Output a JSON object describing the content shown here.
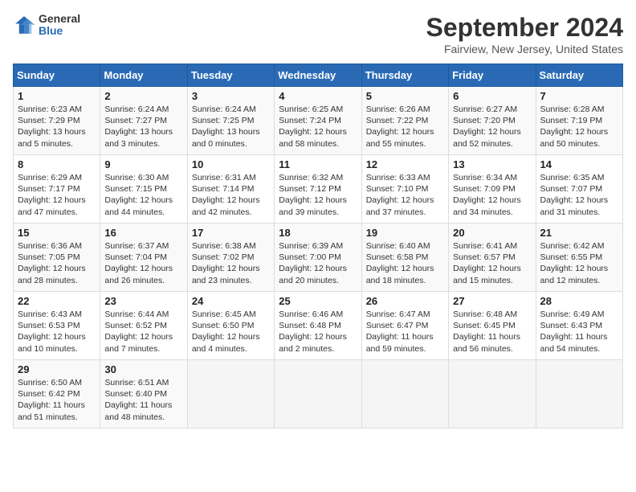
{
  "logo": {
    "general": "General",
    "blue": "Blue"
  },
  "title": "September 2024",
  "subtitle": "Fairview, New Jersey, United States",
  "headers": [
    "Sunday",
    "Monday",
    "Tuesday",
    "Wednesday",
    "Thursday",
    "Friday",
    "Saturday"
  ],
  "weeks": [
    [
      {
        "day": "1",
        "lines": [
          "Sunrise: 6:23 AM",
          "Sunset: 7:29 PM",
          "Daylight: 13 hours",
          "and 5 minutes."
        ]
      },
      {
        "day": "2",
        "lines": [
          "Sunrise: 6:24 AM",
          "Sunset: 7:27 PM",
          "Daylight: 13 hours",
          "and 3 minutes."
        ]
      },
      {
        "day": "3",
        "lines": [
          "Sunrise: 6:24 AM",
          "Sunset: 7:25 PM",
          "Daylight: 13 hours",
          "and 0 minutes."
        ]
      },
      {
        "day": "4",
        "lines": [
          "Sunrise: 6:25 AM",
          "Sunset: 7:24 PM",
          "Daylight: 12 hours",
          "and 58 minutes."
        ]
      },
      {
        "day": "5",
        "lines": [
          "Sunrise: 6:26 AM",
          "Sunset: 7:22 PM",
          "Daylight: 12 hours",
          "and 55 minutes."
        ]
      },
      {
        "day": "6",
        "lines": [
          "Sunrise: 6:27 AM",
          "Sunset: 7:20 PM",
          "Daylight: 12 hours",
          "and 52 minutes."
        ]
      },
      {
        "day": "7",
        "lines": [
          "Sunrise: 6:28 AM",
          "Sunset: 7:19 PM",
          "Daylight: 12 hours",
          "and 50 minutes."
        ]
      }
    ],
    [
      {
        "day": "8",
        "lines": [
          "Sunrise: 6:29 AM",
          "Sunset: 7:17 PM",
          "Daylight: 12 hours",
          "and 47 minutes."
        ]
      },
      {
        "day": "9",
        "lines": [
          "Sunrise: 6:30 AM",
          "Sunset: 7:15 PM",
          "Daylight: 12 hours",
          "and 44 minutes."
        ]
      },
      {
        "day": "10",
        "lines": [
          "Sunrise: 6:31 AM",
          "Sunset: 7:14 PM",
          "Daylight: 12 hours",
          "and 42 minutes."
        ]
      },
      {
        "day": "11",
        "lines": [
          "Sunrise: 6:32 AM",
          "Sunset: 7:12 PM",
          "Daylight: 12 hours",
          "and 39 minutes."
        ]
      },
      {
        "day": "12",
        "lines": [
          "Sunrise: 6:33 AM",
          "Sunset: 7:10 PM",
          "Daylight: 12 hours",
          "and 37 minutes."
        ]
      },
      {
        "day": "13",
        "lines": [
          "Sunrise: 6:34 AM",
          "Sunset: 7:09 PM",
          "Daylight: 12 hours",
          "and 34 minutes."
        ]
      },
      {
        "day": "14",
        "lines": [
          "Sunrise: 6:35 AM",
          "Sunset: 7:07 PM",
          "Daylight: 12 hours",
          "and 31 minutes."
        ]
      }
    ],
    [
      {
        "day": "15",
        "lines": [
          "Sunrise: 6:36 AM",
          "Sunset: 7:05 PM",
          "Daylight: 12 hours",
          "and 28 minutes."
        ]
      },
      {
        "day": "16",
        "lines": [
          "Sunrise: 6:37 AM",
          "Sunset: 7:04 PM",
          "Daylight: 12 hours",
          "and 26 minutes."
        ]
      },
      {
        "day": "17",
        "lines": [
          "Sunrise: 6:38 AM",
          "Sunset: 7:02 PM",
          "Daylight: 12 hours",
          "and 23 minutes."
        ]
      },
      {
        "day": "18",
        "lines": [
          "Sunrise: 6:39 AM",
          "Sunset: 7:00 PM",
          "Daylight: 12 hours",
          "and 20 minutes."
        ]
      },
      {
        "day": "19",
        "lines": [
          "Sunrise: 6:40 AM",
          "Sunset: 6:58 PM",
          "Daylight: 12 hours",
          "and 18 minutes."
        ]
      },
      {
        "day": "20",
        "lines": [
          "Sunrise: 6:41 AM",
          "Sunset: 6:57 PM",
          "Daylight: 12 hours",
          "and 15 minutes."
        ]
      },
      {
        "day": "21",
        "lines": [
          "Sunrise: 6:42 AM",
          "Sunset: 6:55 PM",
          "Daylight: 12 hours",
          "and 12 minutes."
        ]
      }
    ],
    [
      {
        "day": "22",
        "lines": [
          "Sunrise: 6:43 AM",
          "Sunset: 6:53 PM",
          "Daylight: 12 hours",
          "and 10 minutes."
        ]
      },
      {
        "day": "23",
        "lines": [
          "Sunrise: 6:44 AM",
          "Sunset: 6:52 PM",
          "Daylight: 12 hours",
          "and 7 minutes."
        ]
      },
      {
        "day": "24",
        "lines": [
          "Sunrise: 6:45 AM",
          "Sunset: 6:50 PM",
          "Daylight: 12 hours",
          "and 4 minutes."
        ]
      },
      {
        "day": "25",
        "lines": [
          "Sunrise: 6:46 AM",
          "Sunset: 6:48 PM",
          "Daylight: 12 hours",
          "and 2 minutes."
        ]
      },
      {
        "day": "26",
        "lines": [
          "Sunrise: 6:47 AM",
          "Sunset: 6:47 PM",
          "Daylight: 11 hours",
          "and 59 minutes."
        ]
      },
      {
        "day": "27",
        "lines": [
          "Sunrise: 6:48 AM",
          "Sunset: 6:45 PM",
          "Daylight: 11 hours",
          "and 56 minutes."
        ]
      },
      {
        "day": "28",
        "lines": [
          "Sunrise: 6:49 AM",
          "Sunset: 6:43 PM",
          "Daylight: 11 hours",
          "and 54 minutes."
        ]
      }
    ],
    [
      {
        "day": "29",
        "lines": [
          "Sunrise: 6:50 AM",
          "Sunset: 6:42 PM",
          "Daylight: 11 hours",
          "and 51 minutes."
        ]
      },
      {
        "day": "30",
        "lines": [
          "Sunrise: 6:51 AM",
          "Sunset: 6:40 PM",
          "Daylight: 11 hours",
          "and 48 minutes."
        ]
      },
      {
        "day": "",
        "lines": []
      },
      {
        "day": "",
        "lines": []
      },
      {
        "day": "",
        "lines": []
      },
      {
        "day": "",
        "lines": []
      },
      {
        "day": "",
        "lines": []
      }
    ]
  ]
}
